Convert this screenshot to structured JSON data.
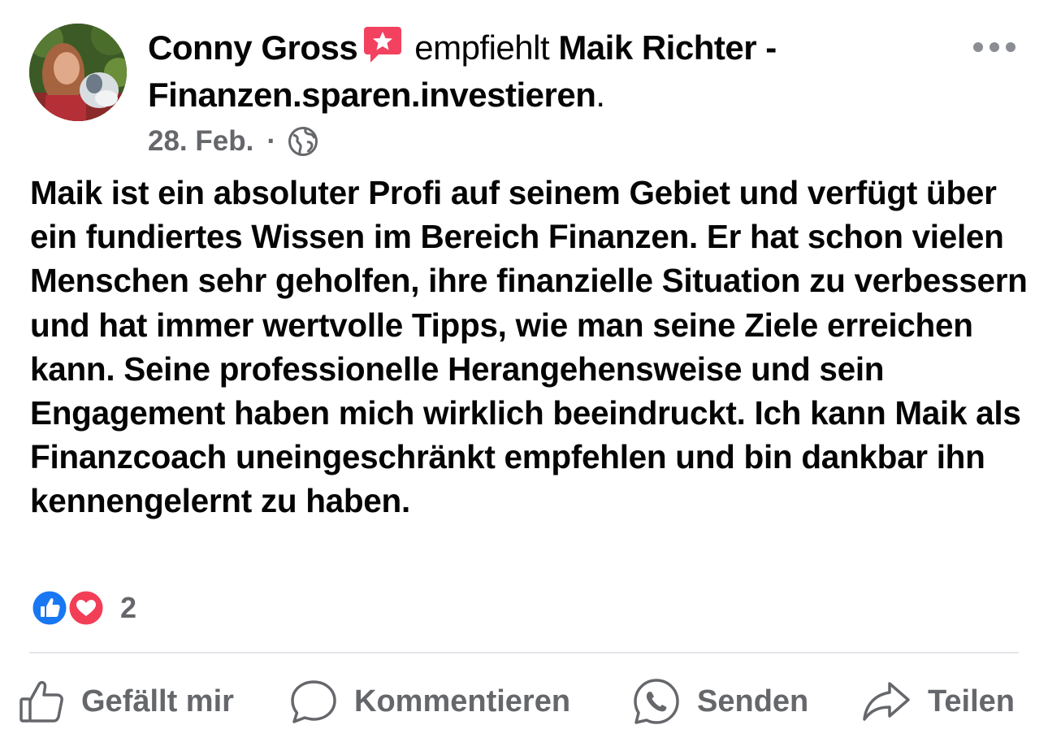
{
  "post": {
    "author": "Conny Gross",
    "recommends_text": "empfiehlt",
    "page_name": "Maik Richter - Finanzen.sparen.investieren",
    "period": ".",
    "date": "28. Feb.",
    "separator": "·",
    "body": "Maik ist ein absoluter Profi auf seinem Gebiet und verfügt über ein fundiertes Wissen im Bereich Finanzen. Er hat schon vielen Menschen sehr geholfen, ihre finanzielle Situation zu verbessern und hat immer wertvolle Tipps, wie man seine Ziele erreichen kann. Seine professionelle Herangehensweise und sein Engagement haben mich wirklich beeindruckt. Ich kann Maik als Finanzcoach uneingeschränkt empfehlen und bin dankbar ihn kennengelernt zu haben.",
    "reaction_count": "2"
  },
  "icons": {
    "recommend": "recommend-star-icon",
    "privacy": "globe-icon",
    "more": "more-options-icon",
    "reaction_like": "like-reaction-icon",
    "reaction_love": "love-reaction-icon"
  },
  "actions": {
    "like": "Gefällt mir",
    "comment": "Kommentieren",
    "send": "Senden",
    "share": "Teilen"
  },
  "colors": {
    "text": "#050505",
    "secondary": "#65676b",
    "like_blue": "#1877f2",
    "love_red": "#f33e58",
    "recommend_red": "#f3425f"
  }
}
